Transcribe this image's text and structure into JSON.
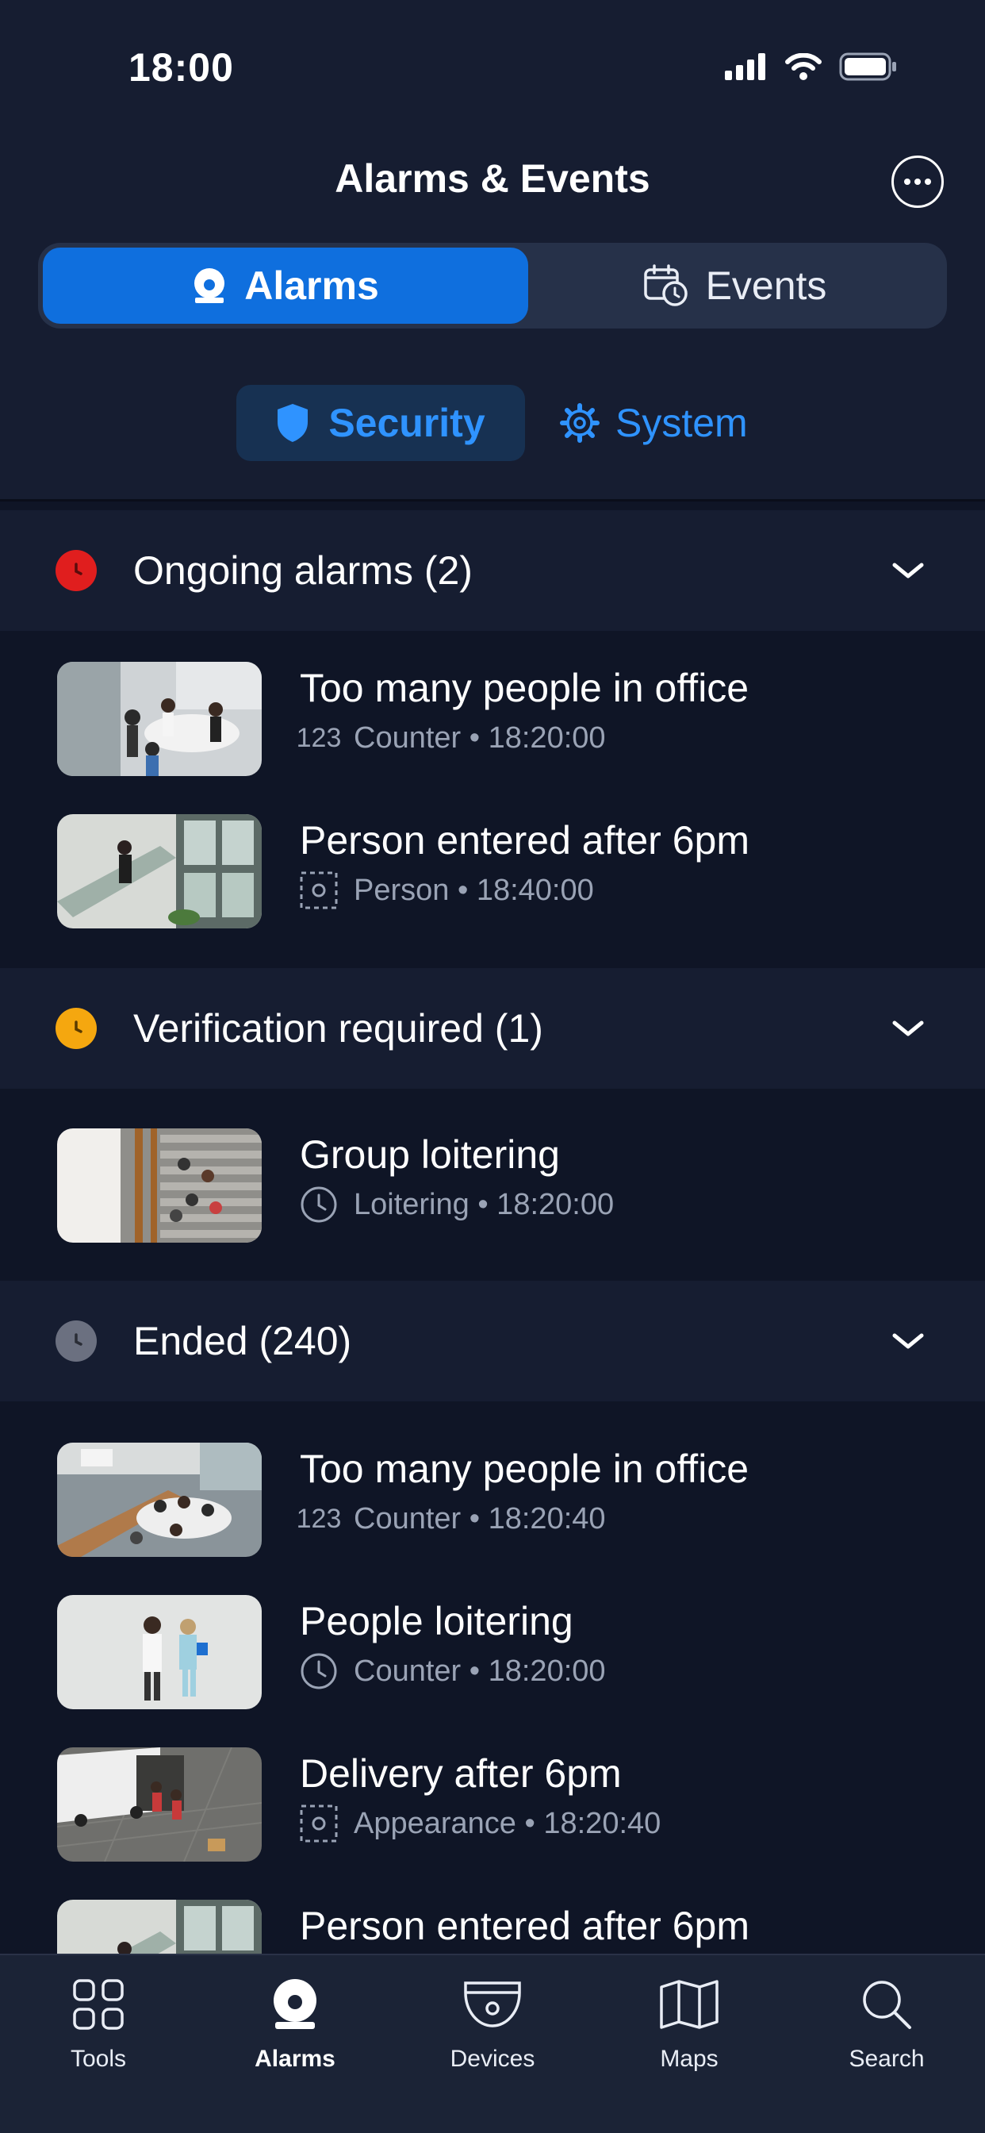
{
  "status_bar": {
    "time": "18:00"
  },
  "header": {
    "title": "Alarms & Events"
  },
  "segments": {
    "alarms": "Alarms",
    "events": "Events"
  },
  "categories": {
    "security": "Security",
    "system": "System"
  },
  "sections": {
    "ongoing": {
      "title": "Ongoing alarms (2)",
      "color": "#e01e1e",
      "items": [
        {
          "title": "Too many people in office",
          "meta_icon": "counter-123-icon",
          "meta_icon_text": "123",
          "meta": "Counter • 18:20:00"
        },
        {
          "title": "Person entered after 6pm",
          "meta_icon": "person-detect-icon",
          "meta": "Person • 18:40:00"
        }
      ]
    },
    "verification": {
      "title": "Verification required (1)",
      "color": "#f5a70f",
      "items": [
        {
          "title": "Group loitering",
          "meta_icon": "clock-icon",
          "meta": "Loitering • 18:20:00"
        }
      ]
    },
    "ended": {
      "title": "Ended (240)",
      "color": "#6b7080",
      "items": [
        {
          "title": "Too many people in office",
          "meta_icon": "counter-123-icon",
          "meta_icon_text": "123",
          "meta": "Counter • 18:20:40"
        },
        {
          "title": "People loitering",
          "meta_icon": "clock-icon",
          "meta": "Counter • 18:20:00"
        },
        {
          "title": "Delivery after 6pm",
          "meta_icon": "appearance-icon",
          "meta": "Appearance • 18:20:40"
        },
        {
          "title": "Person entered after 6pm"
        }
      ]
    }
  },
  "tabbar": {
    "tools": "Tools",
    "alarms": "Alarms",
    "devices": "Devices",
    "maps": "Maps",
    "search": "Search"
  },
  "colors": {
    "accent": "#0f6fde",
    "link": "#2f93ff",
    "background": "#0f1526",
    "header_bg": "#161d31"
  }
}
